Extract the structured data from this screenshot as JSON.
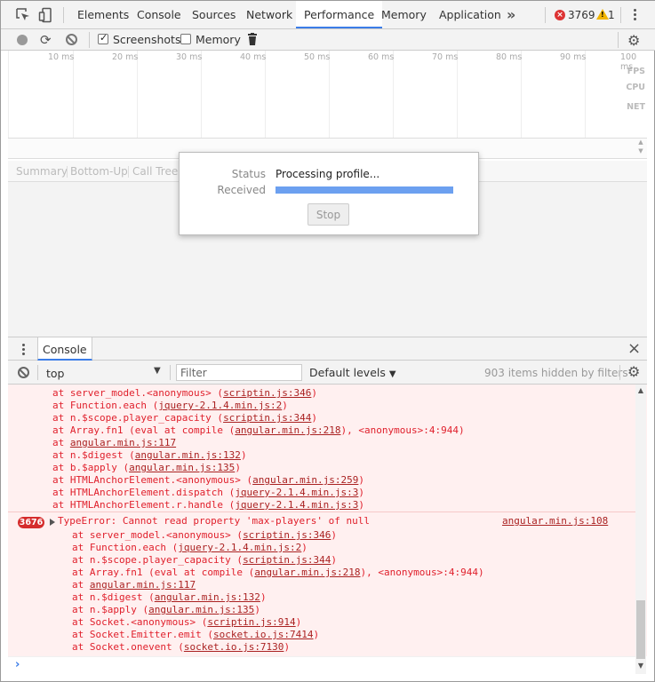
{
  "tabs": [
    {
      "label": "Elements",
      "active": false
    },
    {
      "label": "Console",
      "active": false
    },
    {
      "label": "Sources",
      "active": false
    },
    {
      "label": "Network",
      "active": false
    },
    {
      "label": "Performance",
      "active": true
    },
    {
      "label": "Memory",
      "active": false
    },
    {
      "label": "Application",
      "active": false
    }
  ],
  "more_label": "»",
  "error_badge": "×",
  "error_count": "3769",
  "warning_badge": "!",
  "warning_count": "1",
  "perf_toolbar": {
    "screenshots_label": "Screenshots",
    "screenshots_checked": true,
    "memory_label": "Memory",
    "memory_checked": false
  },
  "timeline": {
    "ticks": [
      "10 ms",
      "20 ms",
      "30 ms",
      "40 ms",
      "50 ms",
      "60 ms",
      "70 ms",
      "80 ms",
      "90 ms",
      "100 ms"
    ],
    "tracks": [
      "FPS",
      "CPU",
      "NET"
    ]
  },
  "lower_tabs": [
    "Summary",
    "Bottom-Up",
    "Call Tree"
  ],
  "modal": {
    "status_label": "Status",
    "status_value": "Processing profile...",
    "received_label": "Received",
    "received_progress": 1.0,
    "stop_label": "Stop"
  },
  "drawer": {
    "tab_label": "Console",
    "close_icon": "×"
  },
  "console_toolbar": {
    "context": "top",
    "filter_placeholder": "Filter",
    "levels_label": "Default levels",
    "levels_arrow": "▼",
    "hidden_text": "903 items hidden by filters"
  },
  "stack1": [
    [
      "at server_model.<anonymous> (",
      "scriptin.js:346",
      ")"
    ],
    [
      "at Function.each (",
      "jquery-2.1.4.min.js:2",
      ")"
    ],
    [
      "at n.$scope.player_capacity (",
      "scriptin.js:344",
      ")"
    ],
    [
      "at Array.fn1 (eval at compile (",
      "angular.min.js:218",
      "), <anonymous>:4:944)"
    ],
    [
      "at ",
      "angular.min.js:117",
      ""
    ],
    [
      "at n.$digest (",
      "angular.min.js:132",
      ")"
    ],
    [
      "at b.$apply (",
      "angular.min.js:135",
      ")"
    ],
    [
      "at HTMLAnchorElement.<anonymous> (",
      "angular.min.js:259",
      ")"
    ],
    [
      "at HTMLAnchorElement.dispatch (",
      "jquery-2.1.4.min.js:3",
      ")"
    ],
    [
      "at HTMLAnchorElement.r.handle (",
      "jquery-2.1.4.min.js:3",
      ")"
    ]
  ],
  "error2": {
    "count": "3676",
    "message": "TypeError: Cannot read property 'max-players' of null",
    "source": "angular.min.js:108"
  },
  "stack2": [
    [
      "at server_model.<anonymous> (",
      "scriptin.js:346",
      ")"
    ],
    [
      "at Function.each (",
      "jquery-2.1.4.min.js:2",
      ")"
    ],
    [
      "at n.$scope.player_capacity (",
      "scriptin.js:344",
      ")"
    ],
    [
      "at Array.fn1 (eval at compile (",
      "angular.min.js:218",
      "), <anonymous>:4:944)"
    ],
    [
      "at ",
      "angular.min.js:117",
      ""
    ],
    [
      "at n.$digest (",
      "angular.min.js:132",
      ")"
    ],
    [
      "at n.$apply (",
      "angular.min.js:135",
      ")"
    ],
    [
      "at Socket.<anonymous> (",
      "scriptin.js:914",
      ")"
    ],
    [
      "at Socket.Emitter.emit (",
      "socket.io.js:7414",
      ")"
    ],
    [
      "at Socket.onevent (",
      "socket.io.js:7130",
      ")"
    ]
  ],
  "prompt_symbol": "›",
  "colors": {
    "accent": "#3b7de8",
    "error": "#e0202c",
    "error_bg": "#fff0f0"
  }
}
